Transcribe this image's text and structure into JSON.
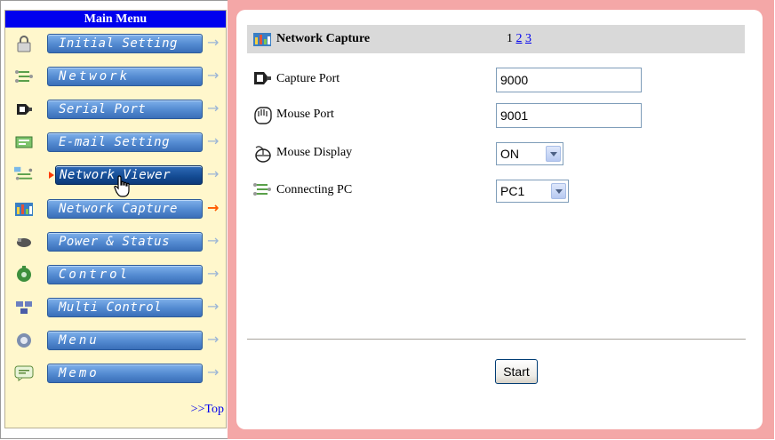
{
  "sidebar": {
    "title": "Main Menu",
    "items": [
      {
        "label": "Initial Setting",
        "icon": "lock-icon"
      },
      {
        "label": "Network",
        "icon": "network-icon"
      },
      {
        "label": "Serial Port",
        "icon": "serial-port-icon"
      },
      {
        "label": "E-mail Setting",
        "icon": "email-icon"
      },
      {
        "label": "Network Viewer",
        "icon": "network-viewer-icon",
        "state": "hover"
      },
      {
        "label": "Network Capture",
        "icon": "network-capture-icon",
        "state": "current"
      },
      {
        "label": "Power & Status",
        "icon": "power-status-icon"
      },
      {
        "label": "Control",
        "icon": "control-icon"
      },
      {
        "label": "Multi Control",
        "icon": "multi-control-icon"
      },
      {
        "label": "Menu",
        "icon": "menu-icon"
      },
      {
        "label": "Memo",
        "icon": "memo-icon"
      }
    ],
    "top_link": ">>Top"
  },
  "main": {
    "title": "Network Capture",
    "pages": {
      "current": "1",
      "links": [
        "2",
        "3"
      ]
    },
    "fields": {
      "capture_port": {
        "label": "Capture Port",
        "value": "9000"
      },
      "mouse_port": {
        "label": "Mouse Port",
        "value": "9001"
      },
      "mouse_display": {
        "label": "Mouse Display",
        "value": "ON"
      },
      "connecting_pc": {
        "label": "Connecting PC",
        "value": "PC1"
      }
    },
    "start_label": "Start"
  },
  "colors": {
    "menu_header": "#0000ee",
    "sidebar_bg": "#fff7cc",
    "main_border": "#f4a7a7",
    "title_bar": "#d9d9d9",
    "current_arrow": "#ff5a00"
  }
}
